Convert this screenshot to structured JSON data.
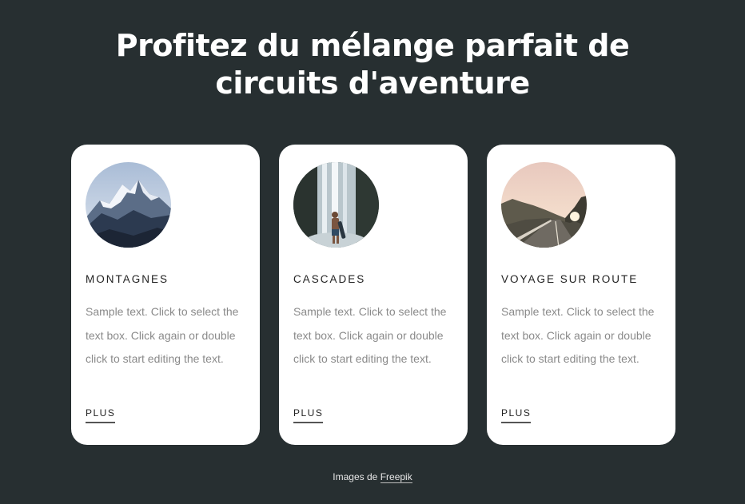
{
  "header": {
    "title_line1": "Profitez du mélange parfait de",
    "title_line2": "circuits d'aventure"
  },
  "cards": [
    {
      "image": "mountain-photo",
      "title": "MONTAGNES",
      "text": "Sample text. Click to select the text box. Click again or double click to start editing the text.",
      "link": "PLUS"
    },
    {
      "image": "waterfall-photo",
      "title": "CASCADES",
      "text": "Sample text. Click to select the text box. Click again or double click to start editing the text.",
      "link": "PLUS"
    },
    {
      "image": "road-trip-photo",
      "title": "VOYAGE SUR ROUTE",
      "text": "Sample text. Click to select the text box. Click again or double click to start editing the text.",
      "link": "PLUS"
    }
  ],
  "footer": {
    "credit_prefix": "Images de",
    "credit_link": "Freepik"
  },
  "colors": {
    "background": "#272f31",
    "card": "#ffffff",
    "body_text": "#8a8a8a",
    "heading_text": "#222222"
  }
}
